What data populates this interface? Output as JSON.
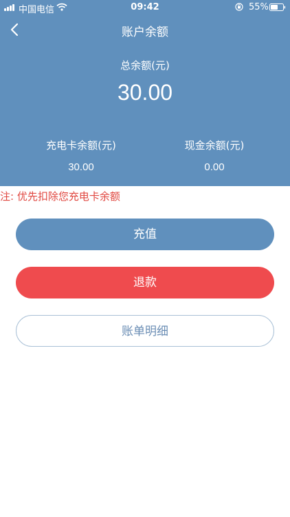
{
  "status_bar": {
    "carrier": "中国电信",
    "time": "09:42",
    "battery": "55%"
  },
  "nav": {
    "title": "账户余额"
  },
  "balance": {
    "total_label": "总余额(元)",
    "total_value": "30.00",
    "card_label": "充电卡余额(元)",
    "card_value": "30.00",
    "cash_label": "现金余额(元)",
    "cash_value": "0.00"
  },
  "note": "注: 优先扣除您充电卡余额",
  "buttons": {
    "recharge": "充值",
    "refund": "退款",
    "bill": "账单明细"
  },
  "colors": {
    "primary": "#6090bd",
    "danger": "#ef4b4e",
    "note": "#e0463f"
  },
  "icons": {
    "back": "chevron-left-icon",
    "wifi": "wifi-icon",
    "signal": "signal-icon",
    "lock": "orientation-lock-icon",
    "battery": "battery-icon"
  }
}
